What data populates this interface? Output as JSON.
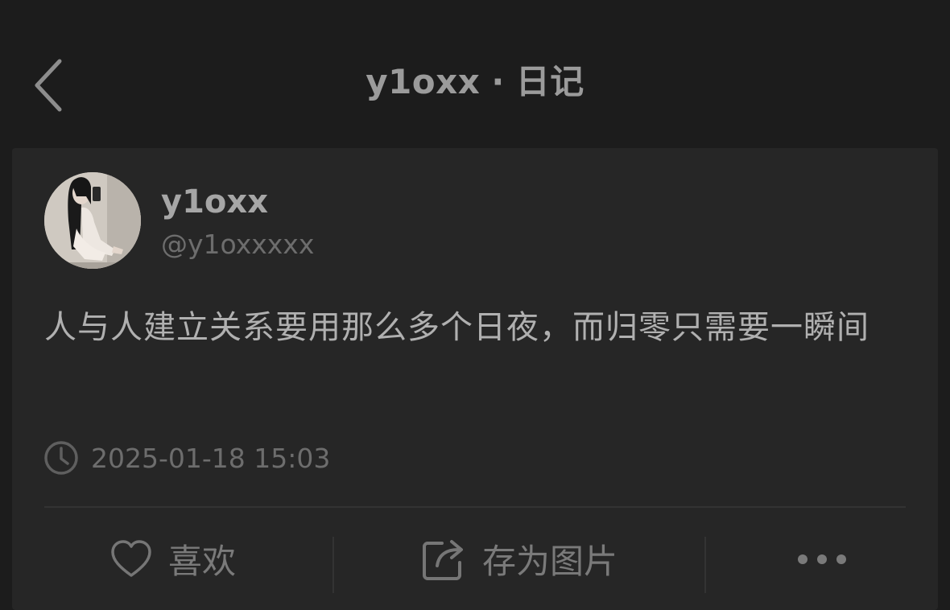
{
  "header": {
    "back_icon": "chevron-left-icon",
    "username": "y1oxx",
    "separator": "·",
    "section": "日记"
  },
  "post": {
    "author": {
      "display_name": "y1oxx",
      "handle": "@y1oxxxxx",
      "avatar": "avatar-photo"
    },
    "text": "人与人建立关系要用那么多个日夜，而归零只需要一瞬间",
    "timestamp": "2025-01-18 15:03",
    "timestamp_icon": "clock-icon"
  },
  "actions": {
    "like": {
      "label": "喜欢",
      "icon": "heart-icon"
    },
    "save_image": {
      "label": "存为图片",
      "icon": "share-icon"
    },
    "more": {
      "icon": "more-dots-icon"
    }
  },
  "colors": {
    "background": "#1c1c1c",
    "card": "#262626",
    "primary_text": "#b0b0b0",
    "secondary_text": "#6d6d6d"
  }
}
